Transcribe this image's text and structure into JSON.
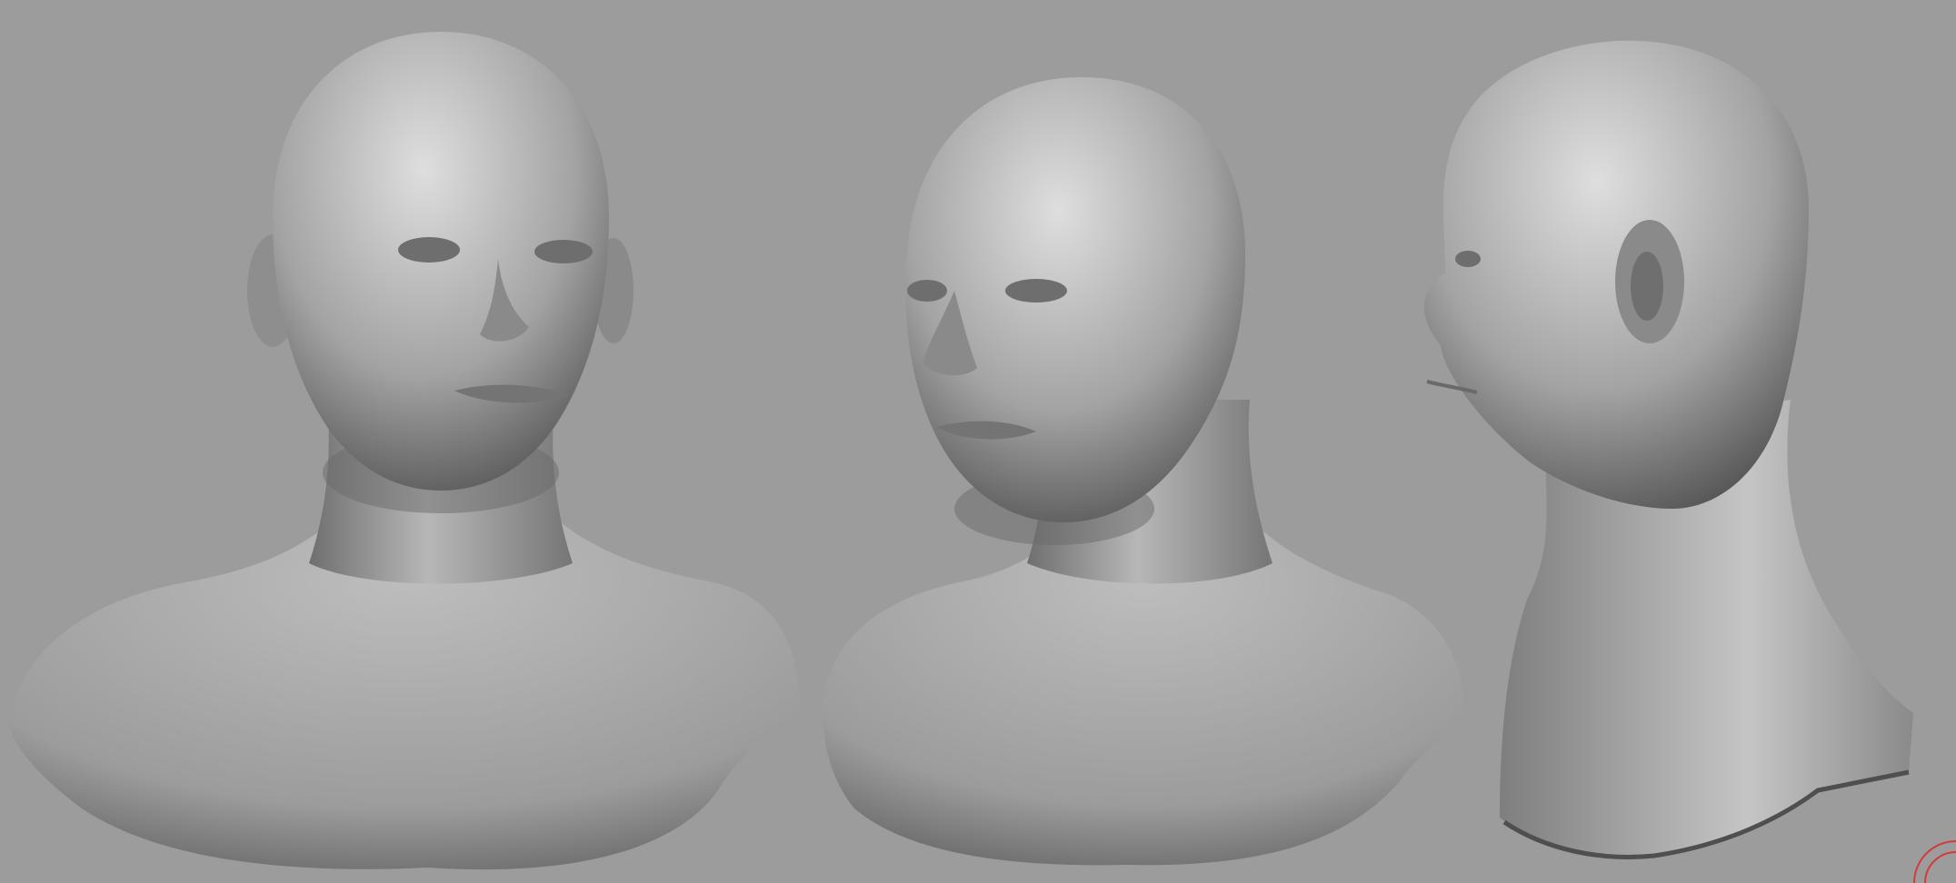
{
  "scene": {
    "background_color": "#9c9c9c",
    "clay_color": "#9a9a9a",
    "clay_highlight_color": "#d9d9d9",
    "clay_shadow_color": "#4a4a4a",
    "views": [
      {
        "name": "bust-front-view"
      },
      {
        "name": "bust-three-quarter-view"
      },
      {
        "name": "bust-side-profile-view"
      }
    ]
  },
  "gizmo": {
    "icon": "axis-gizmo-icon",
    "color": "#d23a3a"
  }
}
